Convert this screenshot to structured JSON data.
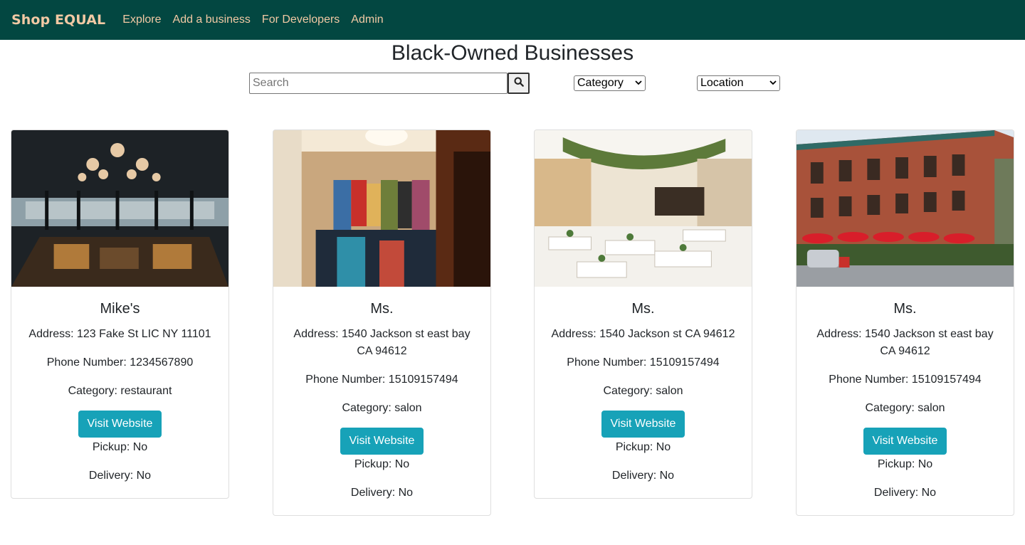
{
  "nav": {
    "brand": "Shop EQUAL",
    "links": [
      "Explore",
      "Add a business",
      "For Developers",
      "Admin"
    ]
  },
  "page": {
    "title": "Black-Owned Businesses"
  },
  "filters": {
    "search_placeholder": "Search",
    "search_icon": "search-icon",
    "category_selected": "Category",
    "location_selected": "Location"
  },
  "colors": {
    "navbar_bg": "#034741",
    "nav_text": "#f2c9a4",
    "button_bg": "#17a2b8"
  },
  "businesses": [
    {
      "name": "Mike's",
      "address": "Address: 123 Fake St LIC NY 11101",
      "phone": "Phone Number: 1234567890",
      "category": "Category: restaurant",
      "button": "Visit Website",
      "pickup": "Pickup: No",
      "delivery": "Delivery: No",
      "image": "restaurant-interior-photo"
    },
    {
      "name": "Ms.",
      "address": "Address: 1540 Jackson st east bay CA 94612",
      "phone": "Phone Number: 15109157494",
      "category": "Category: salon",
      "button": "Visit Website",
      "pickup": "Pickup: No",
      "delivery": "Delivery: No",
      "image": "clothing-boutique-photo"
    },
    {
      "name": "Ms.",
      "address": "Address: 1540 Jackson st CA 94612",
      "phone": "Phone Number: 15109157494",
      "category": "Category: salon",
      "button": "Visit Website",
      "pickup": "Pickup: No",
      "delivery": "Delivery: No",
      "image": "cafe-interior-photo"
    },
    {
      "name": "Ms.",
      "address": "Address: 1540 Jackson st east bay CA 94612",
      "phone": "Phone Number: 15109157494",
      "category": "Category: salon",
      "button": "Visit Website",
      "pickup": "Pickup: No",
      "delivery": "Delivery: No",
      "image": "brick-building-street-photo"
    }
  ]
}
